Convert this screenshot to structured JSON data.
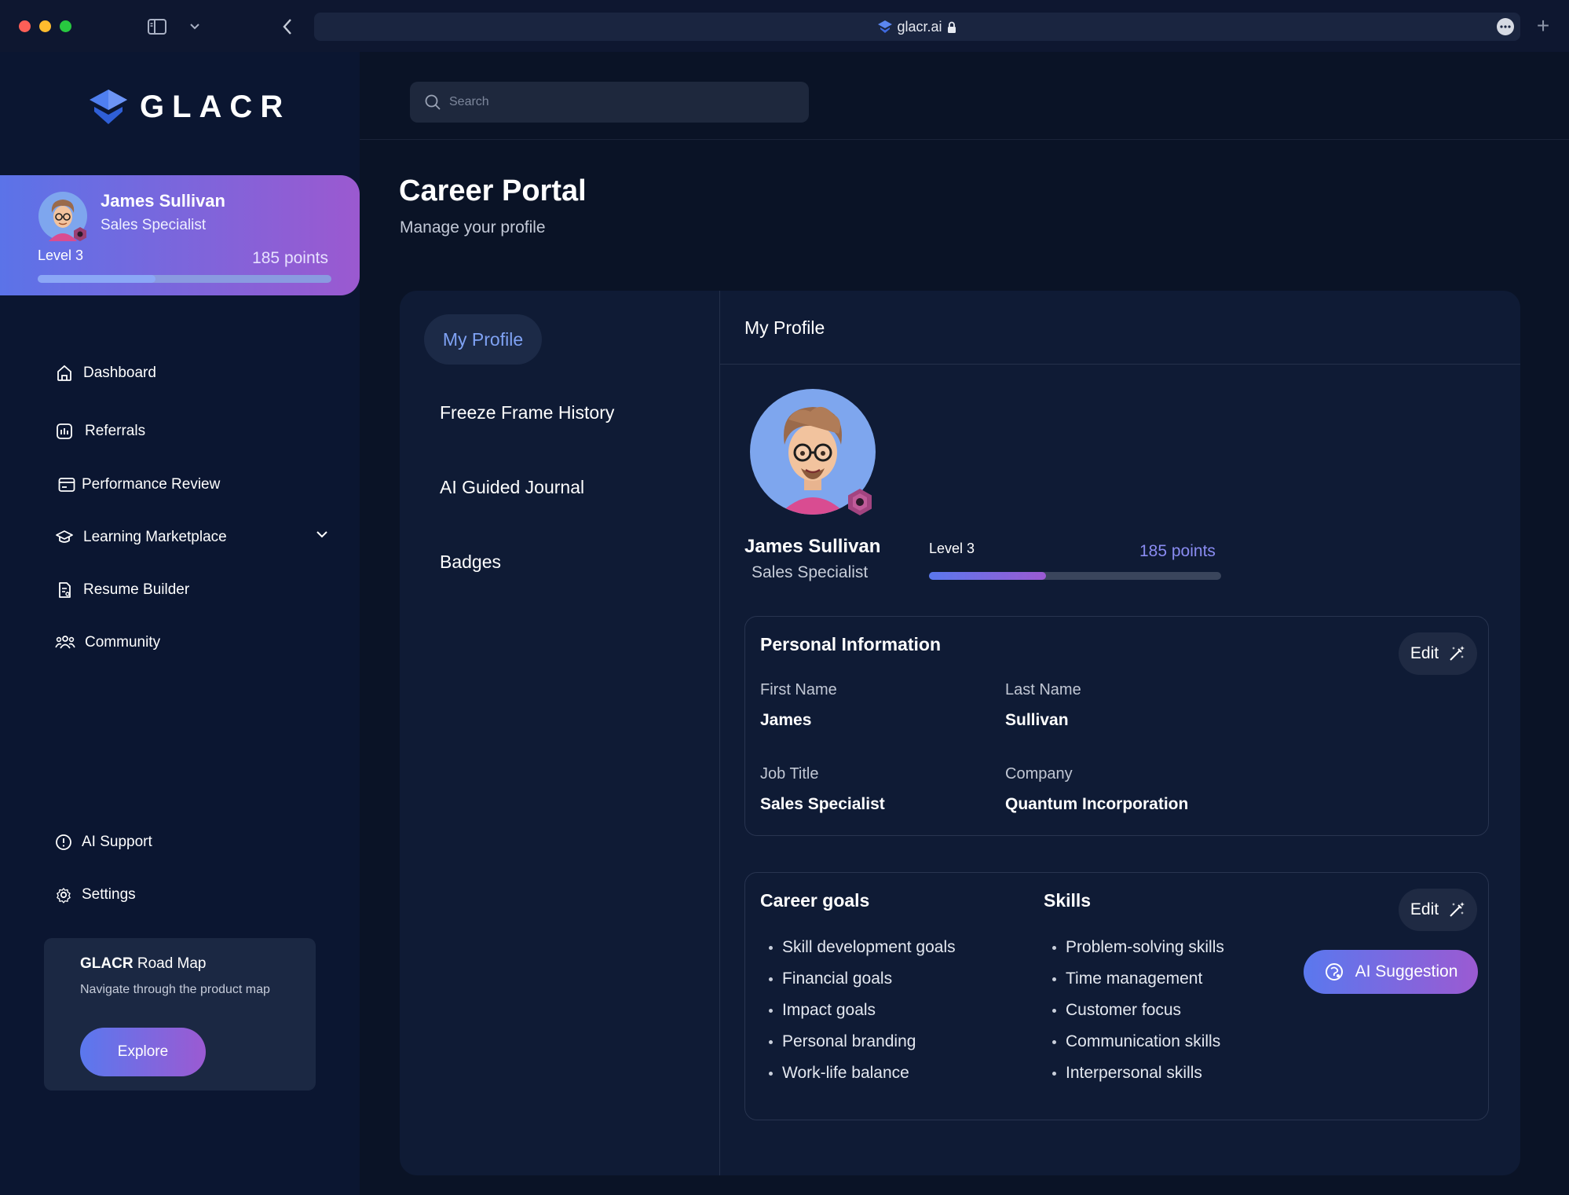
{
  "browser": {
    "url": "glacr.ai"
  },
  "brand": {
    "name": "GLACR"
  },
  "user": {
    "name": "James Sullivan",
    "role": "Sales Specialist",
    "level": "Level 3",
    "points": "185 points",
    "progress_fraction": 0.4
  },
  "nav": {
    "items": [
      {
        "label": "Dashboard",
        "icon": "home-icon"
      },
      {
        "label": "Referrals",
        "icon": "referrals-icon"
      },
      {
        "label": "Performance Review",
        "icon": "card-icon"
      },
      {
        "label": "Learning Marketplace",
        "icon": "graduation-icon"
      },
      {
        "label": "Resume Builder",
        "icon": "document-icon"
      },
      {
        "label": "Community",
        "icon": "people-icon"
      }
    ],
    "bottom_items": [
      {
        "label": "AI Support",
        "icon": "info-icon"
      },
      {
        "label": "Settings",
        "icon": "gear-icon"
      }
    ]
  },
  "roadmap": {
    "title_bold": "GLACR",
    "title_rest": " Road Map",
    "description": "Navigate through the product map",
    "button": "Explore"
  },
  "search": {
    "placeholder": "Search"
  },
  "page": {
    "title": "Career Portal",
    "subtitle": "Manage your profile"
  },
  "tabs": [
    {
      "label": "My Profile",
      "active": true
    },
    {
      "label": "Freeze Frame History",
      "active": false
    },
    {
      "label": "AI Guided Journal",
      "active": false
    },
    {
      "label": "Badges",
      "active": false
    }
  ],
  "profile": {
    "section_title": "My Profile",
    "personal_info": {
      "title": "Personal Information",
      "edit_label": "Edit",
      "first_name_label": "First Name",
      "first_name": "James",
      "last_name_label": "Last Name",
      "last_name": "Sullivan",
      "job_title_label": "Job Title",
      "job_title": "Sales Specialist",
      "company_label": "Company",
      "company": "Quantum Incorporation"
    },
    "career_goals": {
      "title": "Career goals",
      "items": [
        "Skill development goals",
        "Financial goals",
        "Impact goals",
        "Personal branding",
        "Work-life balance"
      ]
    },
    "skills": {
      "title": "Skills",
      "edit_label": "Edit",
      "items": [
        "Problem-solving skills",
        "Time management",
        "Customer focus",
        "Communication skills",
        "Interpersonal skills"
      ]
    },
    "ai_suggestion": "AI Suggestion"
  },
  "colors": {
    "accent_start": "#5a78ee",
    "accent_end": "#9b5ad2",
    "active_tab_text": "#7fa2f4",
    "points_text": "#8a8cf2"
  }
}
